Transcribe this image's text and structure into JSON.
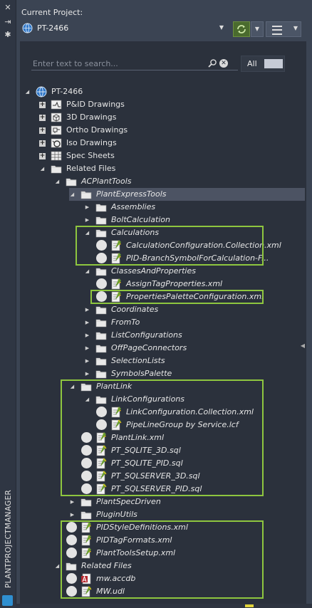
{
  "palette": {
    "title": "PLANTPROJECTMANAGER"
  },
  "header": {
    "current_project_label": "Current Project:",
    "project_name": "PT-2466"
  },
  "search": {
    "placeholder": "Enter text to search...",
    "filter_label": "All"
  },
  "tree": [
    {
      "label": "PT-2466",
      "depth": 0,
      "exp": "open",
      "icon": "project-globe-icon",
      "italic": false
    },
    {
      "label": "P&ID Drawings",
      "depth": 1,
      "exp": "plus",
      "icon": "pid-drawings-icon",
      "italic": false
    },
    {
      "label": "3D Drawings",
      "depth": 1,
      "exp": "plus",
      "icon": "3d-drawings-icon",
      "italic": false
    },
    {
      "label": "Ortho Drawings",
      "depth": 1,
      "exp": "plus",
      "icon": "ortho-drawings-icon",
      "italic": false
    },
    {
      "label": "Iso Drawings",
      "depth": 1,
      "exp": "plus",
      "icon": "iso-drawings-icon",
      "italic": false
    },
    {
      "label": "Spec Sheets",
      "depth": 1,
      "exp": "plus",
      "icon": "spec-sheets-icon",
      "italic": false
    },
    {
      "label": "Related Files",
      "depth": 1,
      "exp": "open",
      "icon": "folder-icon",
      "italic": false
    },
    {
      "label": "ACPlantTools",
      "depth": 2,
      "exp": "open",
      "icon": "folder-icon",
      "italic": true
    },
    {
      "label": "PlantExpressTools",
      "depth": 3,
      "exp": "open",
      "icon": "folder-icon",
      "italic": true,
      "selected": true
    },
    {
      "label": "Assemblies",
      "depth": 4,
      "exp": "closed",
      "icon": "folder-icon",
      "italic": true
    },
    {
      "label": "BoltCalculation",
      "depth": 4,
      "exp": "closed",
      "icon": "folder-icon",
      "italic": true
    },
    {
      "label": "Calculations",
      "depth": 4,
      "exp": "open",
      "icon": "folder-icon",
      "italic": true
    },
    {
      "label": "CalculationConfiguration.Collection.xml",
      "depth": 5,
      "exp": "none",
      "icon": "xml-file-icon",
      "italic": true,
      "status": true
    },
    {
      "label": "PID-BranchSymbolForCalculation-F...",
      "depth": 5,
      "exp": "none",
      "icon": "xml-file-icon",
      "italic": true,
      "status": true
    },
    {
      "label": "ClassesAndProperties",
      "depth": 4,
      "exp": "open",
      "icon": "folder-icon",
      "italic": true
    },
    {
      "label": "AssignTagProperties.xml",
      "depth": 5,
      "exp": "none",
      "icon": "xml-file-icon",
      "italic": true,
      "status": true
    },
    {
      "label": "PropertiesPaletteConfiguration.xml",
      "depth": 5,
      "exp": "none",
      "icon": "xml-file-icon",
      "italic": true,
      "status": true
    },
    {
      "label": "Coordinates",
      "depth": 4,
      "exp": "closed",
      "icon": "folder-icon",
      "italic": true
    },
    {
      "label": "FromTo",
      "depth": 4,
      "exp": "closed",
      "icon": "folder-icon",
      "italic": true
    },
    {
      "label": "ListConfigurations",
      "depth": 4,
      "exp": "closed",
      "icon": "folder-icon",
      "italic": true
    },
    {
      "label": "OffPageConnectors",
      "depth": 4,
      "exp": "closed",
      "icon": "folder-icon",
      "italic": true
    },
    {
      "label": "SelectionLists",
      "depth": 4,
      "exp": "closed",
      "icon": "folder-icon",
      "italic": true
    },
    {
      "label": "SymbolsPalette",
      "depth": 4,
      "exp": "closed",
      "icon": "folder-icon",
      "italic": true
    },
    {
      "label": "PlantLink",
      "depth": 3,
      "exp": "open",
      "icon": "folder-icon",
      "italic": true
    },
    {
      "label": "LinkConfigurations",
      "depth": 4,
      "exp": "open",
      "icon": "folder-icon",
      "italic": true
    },
    {
      "label": "LinkConfiguration.Collection.xml",
      "depth": 5,
      "exp": "none",
      "icon": "xml-file-icon",
      "italic": true,
      "status": true
    },
    {
      "label": "PipeLineGroup by Service.lcf",
      "depth": 5,
      "exp": "none",
      "icon": "lcf-file-icon",
      "italic": true,
      "status": true
    },
    {
      "label": "PlantLink.xml",
      "depth": 4,
      "exp": "none",
      "icon": "xml-file-icon",
      "italic": true,
      "status": true
    },
    {
      "label": "PT_SQLITE_3D.sql",
      "depth": 4,
      "exp": "none",
      "icon": "sql-file-icon",
      "italic": true,
      "status": true
    },
    {
      "label": "PT_SQLITE_PID.sql",
      "depth": 4,
      "exp": "none",
      "icon": "sql-file-icon",
      "italic": true,
      "status": true
    },
    {
      "label": "PT_SQLSERVER_3D.sql",
      "depth": 4,
      "exp": "none",
      "icon": "sql-file-icon",
      "italic": true,
      "status": true
    },
    {
      "label": "PT_SQLSERVER_PID.sql",
      "depth": 4,
      "exp": "none",
      "icon": "sql-file-icon",
      "italic": true,
      "status": true
    },
    {
      "label": "PlantSpecDriven",
      "depth": 3,
      "exp": "closed",
      "icon": "folder-icon",
      "italic": true
    },
    {
      "label": "PluginUtils",
      "depth": 3,
      "exp": "closed",
      "icon": "folder-icon",
      "italic": true
    },
    {
      "label": "PIDStyleDefinitions.xml",
      "depth": 3,
      "exp": "none",
      "icon": "xml-file-icon",
      "italic": true,
      "status": true
    },
    {
      "label": "PIDTagFormats.xml",
      "depth": 3,
      "exp": "none",
      "icon": "xml-file-icon",
      "italic": true,
      "status": true
    },
    {
      "label": "PlantToolsSetup.xml",
      "depth": 3,
      "exp": "none",
      "icon": "xml-file-icon",
      "italic": true,
      "status": true
    },
    {
      "label": "Related Files",
      "depth": 2,
      "exp": "open",
      "icon": "folder-icon",
      "italic": true
    },
    {
      "label": "mw.accdb",
      "depth": 3,
      "exp": "none",
      "icon": "access-db-icon",
      "italic": true,
      "status": true
    },
    {
      "label": "MW.udl",
      "depth": 3,
      "exp": "none",
      "icon": "udl-file-icon",
      "italic": true,
      "status": true
    }
  ],
  "colors": {
    "highlight": "#8ec63f",
    "panel": "#2b313c",
    "chrome": "#3b4453"
  }
}
